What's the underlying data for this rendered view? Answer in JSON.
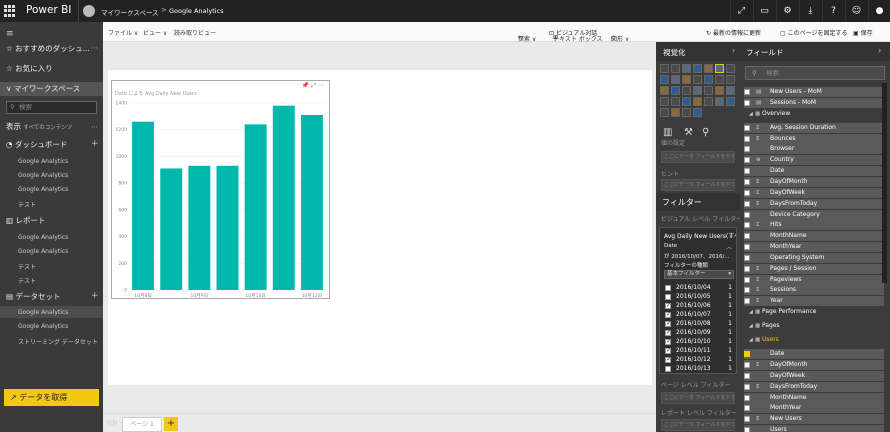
{
  "app": {
    "brand": "Power BI",
    "workspace": "マイワークスペース",
    "breadcrumb_sep": ">",
    "report": "Google Analytics"
  },
  "toolbar": {
    "file": "ファイル ∨",
    "view": "ビュー ∨",
    "reading": "読み取りビュー",
    "explore": "探索 ∨",
    "textbox": "テキスト ボックス",
    "shapes": "図形 ∨",
    "visual_interactions": "ビジュアル対話",
    "refresh": "最新の情報に更新",
    "pin_page": "このページを固定する",
    "save": "保存"
  },
  "nav": {
    "favorites_partial": "おすすめのダッシュ...",
    "favorites": "お気に入り",
    "workspace": "マイワークスペース",
    "search_placeholder": "検索",
    "display": "表示",
    "display_suffix": "すべてのコンテンツ",
    "dashboards": "ダッシュボード",
    "dashboard_items": [
      "Google Analytics",
      "Google Analytics",
      "Google Analytics",
      "テスト"
    ],
    "reports": "レポート",
    "report_items": [
      "Google Analytics",
      "Google Analytics",
      "テスト",
      "テスト"
    ],
    "datasets": "データセット",
    "dataset_items": [
      "Google Analytics",
      "Google Analytics",
      "ストリーミング データセット"
    ],
    "get_data": "↗ データを取得"
  },
  "pages": {
    "tab": "ページ 1",
    "add": "+",
    "prev": "◁",
    "next": "▷"
  },
  "visual": {
    "title": "Date による Avg Daily New Users",
    "icons": "📌 ⤢ ⋯"
  },
  "chart_data": {
    "type": "bar",
    "categories": [
      "10月8日",
      "",
      "10月9日",
      "",
      "10月10日",
      "",
      "10月12日"
    ],
    "values": [
      1260,
      910,
      930,
      930,
      1240,
      1380,
      1310
    ],
    "yticks": [
      0,
      200,
      400,
      600,
      800,
      1000,
      1200,
      1400
    ],
    "ylim": [
      0,
      1400
    ],
    "color": "#01b8aa"
  },
  "viz": {
    "title": "視覚化",
    "arrow": "›",
    "value_label": "値の設定",
    "well_hint": "ここにデータ フィールドをドラ...",
    "tooltip_label": "ヒント",
    "filters": "フィルター",
    "visual_level": "ビジュアル レベル フィルター",
    "page_level": "ページ レベル フィルター",
    "report_level": "レポート レベル フィルター",
    "fcard_title": "Avg Daily New Users(すべ...",
    "fcard_field": "Date",
    "fcard_cond": "が 2016/10/07、2016/...",
    "fcard_type": "フィルターの種類",
    "fcard_select": "基本フィルター",
    "filter_rows": [
      {
        "date": "2016/10/04",
        "count": "1",
        "checked": false
      },
      {
        "date": "2016/10/05",
        "count": "1",
        "checked": false
      },
      {
        "date": "2016/10/06",
        "count": "1",
        "checked": true
      },
      {
        "date": "2016/10/07",
        "count": "1",
        "checked": true
      },
      {
        "date": "2016/10/08",
        "count": "1",
        "checked": true
      },
      {
        "date": "2016/10/09",
        "count": "1",
        "checked": true
      },
      {
        "date": "2016/10/10",
        "count": "1",
        "checked": true
      },
      {
        "date": "2016/10/11",
        "count": "1",
        "checked": true
      },
      {
        "date": "2016/10/12",
        "count": "1",
        "checked": true
      },
      {
        "date": "2016/10/13",
        "count": "1",
        "checked": false
      }
    ]
  },
  "fields": {
    "title": "フィールド",
    "arrow": "›",
    "search_placeholder": "検索",
    "items": [
      {
        "name": "New Users - MoM",
        "kind": "measure",
        "table": false
      },
      {
        "name": "Sessions - MoM",
        "kind": "measure",
        "table": false
      },
      {
        "name": "Overview",
        "kind": "table",
        "table": true
      },
      {
        "name": "Avg. Session Duration",
        "kind": "sum",
        "table": false
      },
      {
        "name": "Bounces",
        "kind": "sum",
        "table": false
      },
      {
        "name": "Browser",
        "kind": "",
        "table": false
      },
      {
        "name": "Country",
        "kind": "globe",
        "table": false
      },
      {
        "name": "Date",
        "kind": "",
        "table": false
      },
      {
        "name": "DayOfMonth",
        "kind": "sum",
        "table": false
      },
      {
        "name": "DayOfWeek",
        "kind": "sum",
        "table": false
      },
      {
        "name": "DaysFromToday",
        "kind": "sum",
        "table": false
      },
      {
        "name": "Device Category",
        "kind": "",
        "table": false
      },
      {
        "name": "Hits",
        "kind": "sum",
        "table": false
      },
      {
        "name": "MonthName",
        "kind": "",
        "table": false
      },
      {
        "name": "MonthYear",
        "kind": "",
        "table": false
      },
      {
        "name": "Operating System",
        "kind": "",
        "table": false
      },
      {
        "name": "Pages / Session",
        "kind": "sum",
        "table": false
      },
      {
        "name": "Pageviews",
        "kind": "sum",
        "table": false
      },
      {
        "name": "Sessions",
        "kind": "sum",
        "table": false
      },
      {
        "name": "Year",
        "kind": "sum",
        "table": false
      },
      {
        "name": "Page Performance",
        "kind": "table",
        "table": true
      },
      {
        "name": "Pages",
        "kind": "table",
        "table": true
      },
      {
        "name": "Users",
        "kind": "table",
        "table": true,
        "highlight": true
      },
      {
        "name": "Date",
        "kind": "",
        "table": false,
        "checked": true
      },
      {
        "name": "DayOfMonth",
        "kind": "sum",
        "table": false
      },
      {
        "name": "DayOfWeek",
        "kind": "",
        "table": false
      },
      {
        "name": "DaysFromToday",
        "kind": "sum",
        "table": false
      },
      {
        "name": "MonthName",
        "kind": "",
        "table": false
      },
      {
        "name": "MonthYear",
        "kind": "",
        "table": false
      },
      {
        "name": "New Users",
        "kind": "sum",
        "table": false
      },
      {
        "name": "Users",
        "kind": "",
        "table": false
      },
      {
        "name": "Year",
        "kind": "sum",
        "table": false
      }
    ]
  }
}
